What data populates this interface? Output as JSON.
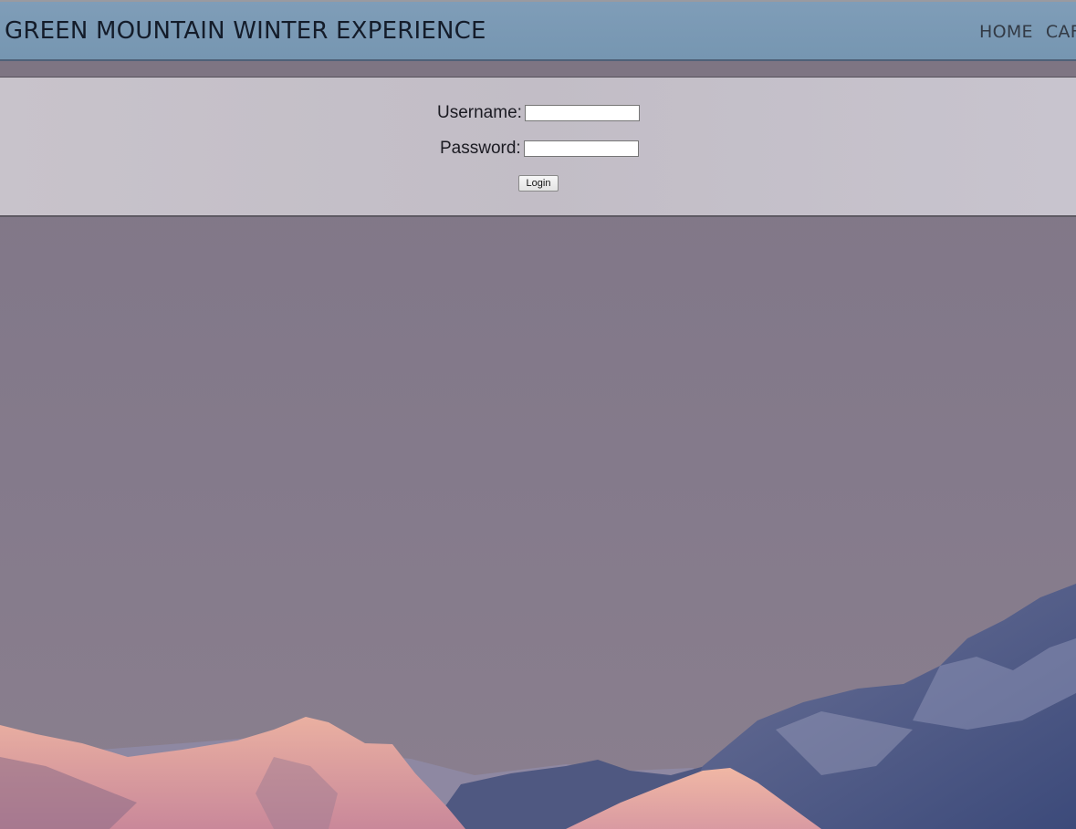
{
  "header": {
    "site_title": "GREEN MOUNTAIN WINTER EXPERIENCE",
    "nav": [
      {
        "label": "HOME"
      },
      {
        "label": "CAF"
      }
    ]
  },
  "login_form": {
    "username_label": "Username:",
    "username_value": "",
    "password_label": "Password:",
    "password_value": "",
    "login_button_label": "Login"
  },
  "colors": {
    "header_bg": "#7a99b4",
    "panel_bg": "#c5c0c9",
    "sky": "#807787",
    "peak_pink": "#e0a79b",
    "shadow_blue": "#3f4c78"
  }
}
